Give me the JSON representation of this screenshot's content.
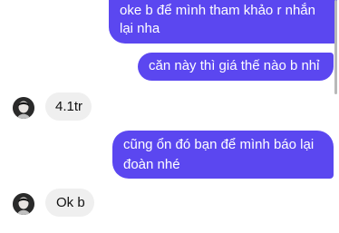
{
  "messages": [
    {
      "direction": "outgoing",
      "lines": [
        "oke b để mình tham khảo r nhắn",
        "lại nha"
      ]
    },
    {
      "direction": "outgoing",
      "lines": [
        "căn này thì giá thế nào b nhỉ"
      ]
    },
    {
      "direction": "incoming",
      "lines": [
        "4.1tr"
      ],
      "avatar_icon": "user-avatar-icon"
    },
    {
      "direction": "outgoing",
      "lines": [
        "cũng ổn đó bạn để mình báo lại",
        "đoàn nhé"
      ]
    },
    {
      "direction": "incoming",
      "lines": [
        "Ok b"
      ],
      "avatar_icon": "user-avatar-icon"
    }
  ],
  "colors": {
    "outgoing_bubble": "#5b47f0",
    "incoming_bubble": "#efefef",
    "background": "#ffffff",
    "scrollbar": "#b8b8b8"
  }
}
